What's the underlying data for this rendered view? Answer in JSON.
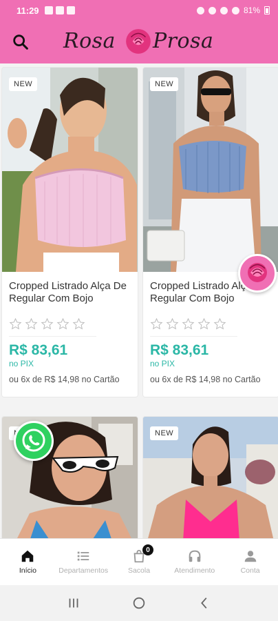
{
  "status_bar": {
    "time": "11:29",
    "battery": "81%"
  },
  "header": {
    "logo_left": "Rosa",
    "logo_right": "Prosa"
  },
  "products": [
    {
      "badge": "NEW",
      "name": "Cropped Listrado Alça De Regular Com Bojo",
      "rating": 0,
      "price": "R$ 83,61",
      "price_note": "no PIX",
      "installments": "ou 6x de R$ 14,98 no Cartão",
      "top_color": "#f2c6de"
    },
    {
      "badge": "NEW",
      "name": "Cropped Listrado Alça De Regular Com Bojo",
      "rating": 0,
      "price": "R$ 83,61",
      "price_note": "no PIX",
      "installments": "ou 6x de R$ 14,98 no Cartão",
      "top_color": "#7b98c8"
    },
    {
      "badge": "NEW",
      "name": "",
      "top_color": "#3a8fd0"
    },
    {
      "badge": "NEW",
      "name": "",
      "top_color": "#ff2d8f"
    }
  ],
  "bottom_nav": [
    {
      "label": "Início",
      "icon": "home-icon",
      "active": true
    },
    {
      "label": "Departamentos",
      "icon": "list-icon",
      "active": false
    },
    {
      "label": "Sacola",
      "icon": "bag-icon",
      "active": false,
      "count": "0"
    },
    {
      "label": "Atendimento",
      "icon": "headset-icon",
      "active": false
    },
    {
      "label": "Conta",
      "icon": "user-icon",
      "active": false
    }
  ],
  "colors": {
    "brand": "#f06fb4",
    "price": "#2bb7a6",
    "whatsapp": "#2fd160"
  }
}
